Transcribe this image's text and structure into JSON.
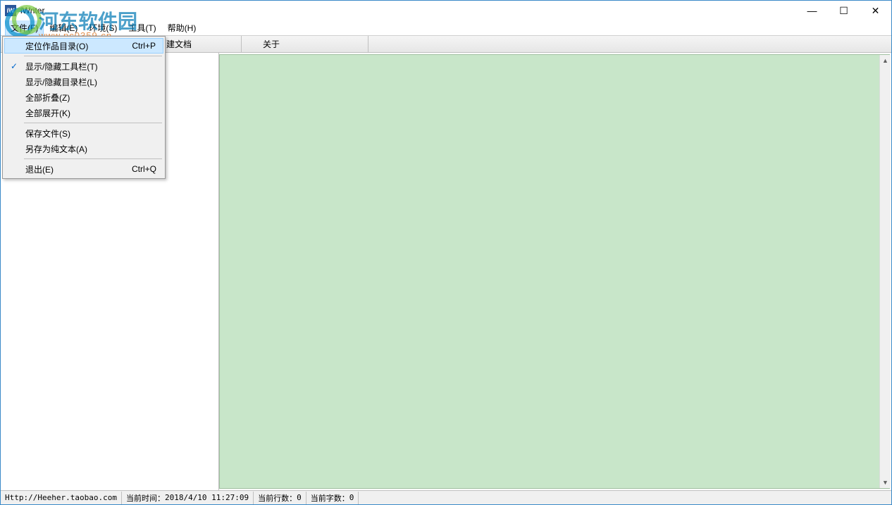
{
  "titlebar": {
    "app_icon_text": "iW",
    "title": "iWriter"
  },
  "menubar": {
    "items": [
      {
        "label": "文件(F)"
      },
      {
        "label": "编辑(E)"
      },
      {
        "label": "环境(S)"
      },
      {
        "label": "工具(T)"
      },
      {
        "label": "帮助(H)"
      }
    ]
  },
  "tabstrip": {
    "tabs": [
      {
        "label": "建文档"
      },
      {
        "label": "关于"
      }
    ]
  },
  "dropdown": {
    "items": [
      {
        "label": "定位作品目录(O)",
        "shortcut": "Ctrl+P",
        "checked": false,
        "highlight": true
      },
      {
        "sep": true
      },
      {
        "label": "显示/隐藏工具栏(T)",
        "shortcut": "",
        "checked": true,
        "highlight": false
      },
      {
        "label": "显示/隐藏目录栏(L)",
        "shortcut": "",
        "checked": false,
        "highlight": false
      },
      {
        "label": "全部折叠(Z)",
        "shortcut": "",
        "checked": false,
        "highlight": false
      },
      {
        "label": "全部展开(K)",
        "shortcut": "",
        "checked": false,
        "highlight": false
      },
      {
        "sep": true
      },
      {
        "label": "保存文件(S)",
        "shortcut": "",
        "checked": false,
        "highlight": false
      },
      {
        "label": "另存为纯文本(A)",
        "shortcut": "",
        "checked": false,
        "highlight": false
      },
      {
        "sep": true
      },
      {
        "label": "退出(E)",
        "shortcut": "Ctrl+Q",
        "checked": false,
        "highlight": false
      }
    ]
  },
  "statusbar": {
    "url": "Http://Heeher.taobao.com",
    "time_label": "当前时间：",
    "time_value": "2018/4/10 11:27:09",
    "lines_label": "当前行数：",
    "lines_value": "0",
    "chars_label": "当前字数：",
    "chars_value": "0"
  },
  "watermark": {
    "cn": "河东软件园",
    "en": "www.pc0359.cn"
  },
  "win_controls": {
    "min": "—",
    "max": "☐",
    "close": "✕"
  }
}
